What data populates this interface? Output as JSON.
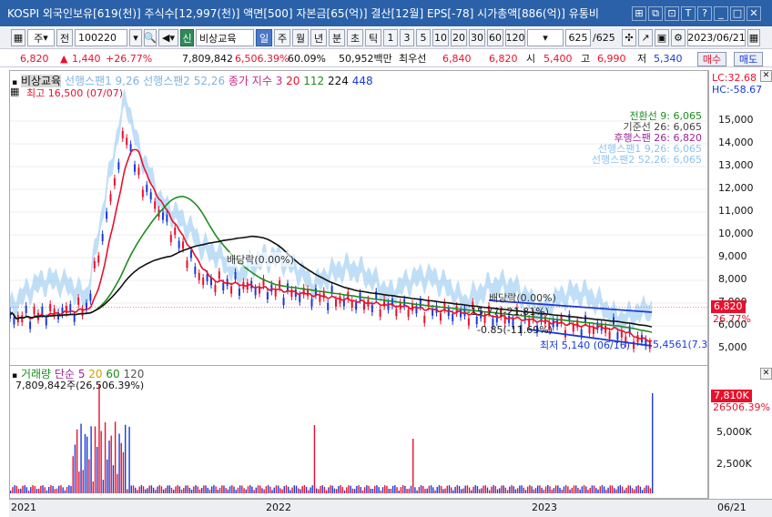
{
  "titlebar": {
    "title": "KOSPI 외국인보유[619(천)] 주식수[12,997(천)] 액면[500] 자본금[65(억)] 결산[12월] EPS[-78] 시가총액[886(억)] 유통비",
    "icons": [
      "window-icon",
      "restore-icon",
      "link-icon",
      "font-size-icon",
      "help-icon",
      "minimize-icon",
      "maximize-icon",
      "close-icon"
    ],
    "glyphs": [
      "⊞",
      "⧉",
      "⊡",
      "T",
      "?",
      "_",
      "□",
      "✕"
    ]
  },
  "toolbar": {
    "market_label": "주",
    "prev_label": "전",
    "code_value": "100220",
    "name_badge": "신",
    "stock_name": "비상교육",
    "periods": [
      "일",
      "주",
      "월",
      "년",
      "분",
      "초",
      "틱"
    ],
    "active_period": "일",
    "intervals": [
      "1",
      "3",
      "5",
      "10",
      "20",
      "30",
      "60",
      "120"
    ],
    "count_value": "625",
    "count_total": "/625",
    "date_value": "2023/06/21"
  },
  "quote": {
    "price": "6,820",
    "change": "1,440",
    "change_pct": "+26.77%",
    "volume": "7,809,842",
    "volume_ratio": "6,506.39%",
    "turnover": "60.09%",
    "amount": "50,952백만",
    "best_label": "최우선",
    "ask": "6,840",
    "bid": "6,820",
    "open_label": "시",
    "open": "5,400",
    "high_label": "고",
    "high": "6,990",
    "low_label": "저",
    "low": "5,340",
    "buy_button": "매수",
    "sell_button": "매도"
  },
  "legend": {
    "name": "비상교육",
    "line1": "선행스팬1 9,26",
    "line2": "선행스팬2 52,26",
    "line3": "종가 지수 3",
    "n20": "20",
    "n112": "112",
    "n224": "224",
    "n448": "448"
  },
  "ichimoku_labels": [
    "전환선 9: 6,065",
    "기준선 26: 6,065",
    "후행스팬 26: 6,820",
    "선행스팬1 9,26: 6,065",
    "선행스팬2 52,26: 6,065"
  ],
  "annotations": {
    "high_label": "최고 16,500 (07/07)",
    "dividend1": "배당락(0.00%)",
    "dividend2": "배당락(0.00%)",
    "pct1": "-15.77(-21.81%)",
    "pct2": "-0.85(-11.69%)",
    "low_label": "최저 5,140 (06/16)",
    "level_right": "5,4561(7.3",
    "lc": "LC:32.68",
    "hc": "HC:-58.67"
  },
  "price_axis": {
    "ticks": [
      "15,000",
      "14,000",
      "13,000",
      "12,000",
      "11,000",
      "10,000",
      "9,000",
      "8,000",
      "7,000",
      "6,000",
      "5,000"
    ],
    "current": "6,820",
    "current_pct": "26.77%"
  },
  "volume_panel": {
    "title": "거래량",
    "ma_label": "단순",
    "ma1": "5",
    "ma2": "20",
    "ma3": "60",
    "ma4": "120",
    "value_line": "7,809,842주(26,506.39%)",
    "axis_ticks": [
      "5,000K",
      "2,500K"
    ],
    "current": "7,810K",
    "current_pct": "26506.39%"
  },
  "x_axis": {
    "labels": [
      "2021",
      "2022",
      "2023"
    ],
    "right_label": "06/21"
  },
  "colors": {
    "up": "#e8112d",
    "down": "#1a3ad8",
    "cloud": "#8cc4f0",
    "ma_green": "#1e8c1e",
    "ma_black": "#111111",
    "titlebar": "#2a61a8"
  }
}
